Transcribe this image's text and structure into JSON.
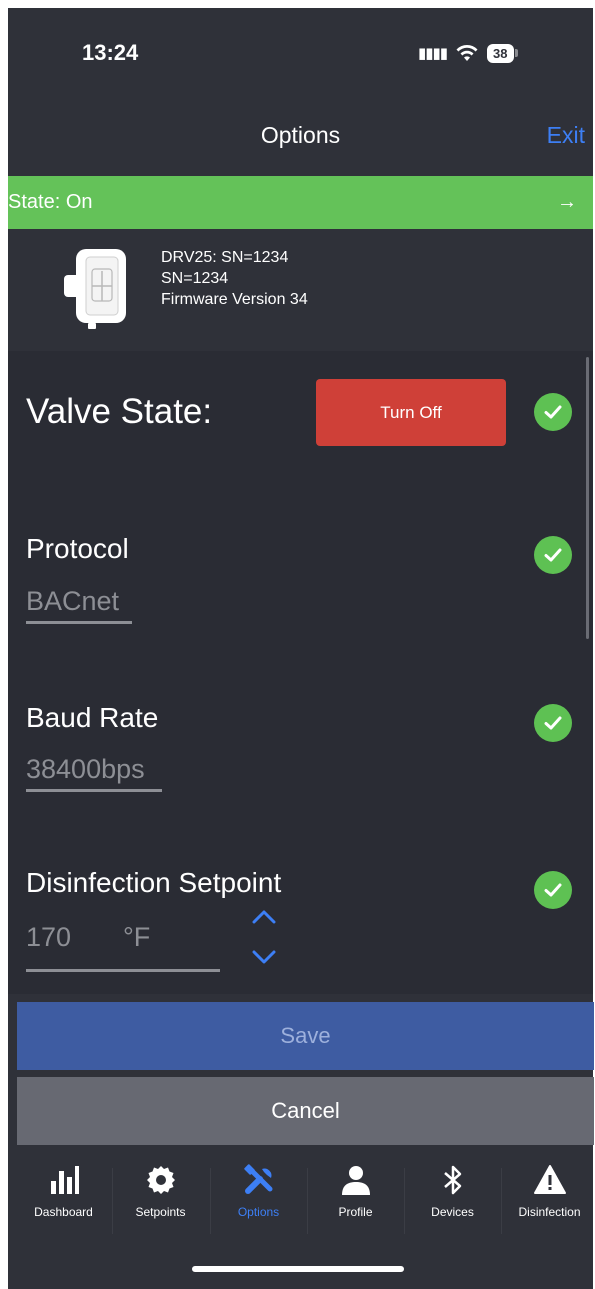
{
  "status_bar": {
    "time": "13:24",
    "battery": "38"
  },
  "header": {
    "title": "Options",
    "exit_label": "Exit"
  },
  "state_bar": {
    "label": "State: On",
    "arrow": "→"
  },
  "device": {
    "line1": "DRV25: SN=1234",
    "line2": "SN=1234",
    "line3": "Firmware Version 34"
  },
  "valve": {
    "label": "Valve State:",
    "button_label": "Turn Off",
    "button_color": "#cf4038"
  },
  "protocol": {
    "title": "Protocol",
    "value": "BACnet"
  },
  "baud": {
    "title": "Baud Rate",
    "value": "38400bps"
  },
  "disinfection_setpoint": {
    "title": "Disinfection Setpoint",
    "value": "170",
    "unit": "°F"
  },
  "actions": {
    "save_label": "Save",
    "cancel_label": "Cancel"
  },
  "tabs": [
    {
      "label": "Dashboard",
      "icon": "bar-chart-icon"
    },
    {
      "label": "Setpoints",
      "icon": "gear-icon"
    },
    {
      "label": "Options",
      "icon": "tools-icon",
      "active": true
    },
    {
      "label": "Profile",
      "icon": "person-icon"
    },
    {
      "label": "Devices",
      "icon": "bluetooth-icon"
    },
    {
      "label": "Disinfection",
      "icon": "warning-icon"
    }
  ],
  "colors": {
    "accent": "#3d7ff5",
    "state_on": "#64c259",
    "check": "#5ec153",
    "save": "#3e5ca2"
  }
}
